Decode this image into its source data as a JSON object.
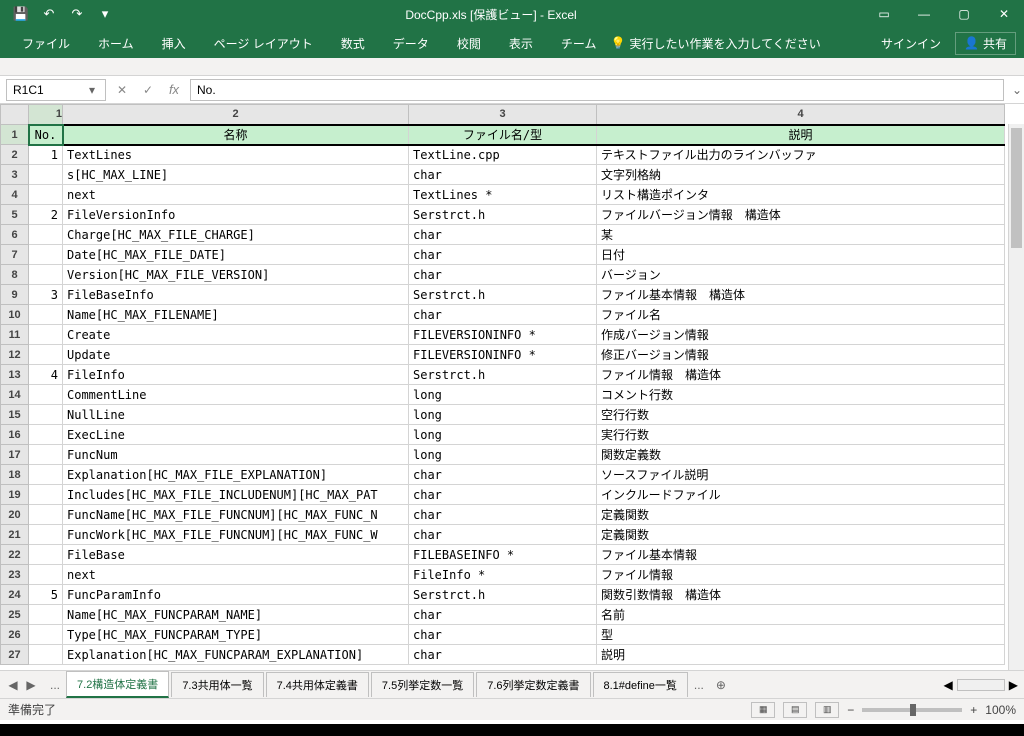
{
  "titlebar": {
    "title": "DocCpp.xls  [保護ビュー] - Excel"
  },
  "qat": {
    "save": "💾",
    "undo": "↶",
    "redo": "↷",
    "dd": "▾"
  },
  "winbtns": {
    "ribbon": "▭",
    "min": "—",
    "max": "▢",
    "close": "✕"
  },
  "tabs": {
    "file": "ファイル",
    "home": "ホーム",
    "insert": "挿入",
    "layout": "ページ レイアウト",
    "formula": "数式",
    "data": "データ",
    "review": "校閲",
    "view": "表示",
    "team": "チーム"
  },
  "tellme": {
    "icon": "💡",
    "text": "実行したい作業を入力してください"
  },
  "signin": "サインイン",
  "share": {
    "icon": "👤",
    "label": "共有"
  },
  "namebox": "R1C1",
  "fb": {
    "cancel": "✕",
    "enter": "✓",
    "fx": "fx"
  },
  "formula": "No.",
  "cols": {
    "c1": "1",
    "c2": "2",
    "c3": "3",
    "c4": "4"
  },
  "headers": {
    "no": "No.",
    "name": "名称",
    "file": "ファイル名/型",
    "desc": "説明"
  },
  "rows": [
    {
      "r": "2",
      "no": "1",
      "name": "TextLines",
      "file": "TextLine.cpp",
      "desc": "テキストファイル出力のラインバッファ"
    },
    {
      "r": "3",
      "no": "",
      "name": "s[HC_MAX_LINE]",
      "file": "char",
      "desc": "文字列格納"
    },
    {
      "r": "4",
      "no": "",
      "name": "next",
      "file": "TextLines *",
      "desc": "リスト構造ポインタ"
    },
    {
      "r": "5",
      "no": "2",
      "name": "FileVersionInfo",
      "file": "Serstrct.h",
      "desc": "ファイルバージョン情報　構造体"
    },
    {
      "r": "6",
      "no": "",
      "name": "Charge[HC_MAX_FILE_CHARGE]",
      "file": "char",
      "desc": "某"
    },
    {
      "r": "7",
      "no": "",
      "name": "Date[HC_MAX_FILE_DATE]",
      "file": "char",
      "desc": "日付"
    },
    {
      "r": "8",
      "no": "",
      "name": "Version[HC_MAX_FILE_VERSION]",
      "file": "char",
      "desc": "バージョン"
    },
    {
      "r": "9",
      "no": "3",
      "name": "FileBaseInfo",
      "file": "Serstrct.h",
      "desc": "ファイル基本情報　構造体"
    },
    {
      "r": "10",
      "no": "",
      "name": "Name[HC_MAX_FILENAME]",
      "file": "char",
      "desc": "ファイル名"
    },
    {
      "r": "11",
      "no": "",
      "name": "Create",
      "file": "FILEVERSIONINFO *",
      "desc": "作成バージョン情報"
    },
    {
      "r": "12",
      "no": "",
      "name": "Update",
      "file": "FILEVERSIONINFO *",
      "desc": "修正バージョン情報"
    },
    {
      "r": "13",
      "no": "4",
      "name": "FileInfo",
      "file": "Serstrct.h",
      "desc": "ファイル情報　構造体"
    },
    {
      "r": "14",
      "no": "",
      "name": "CommentLine",
      "file": "long",
      "desc": "コメント行数"
    },
    {
      "r": "15",
      "no": "",
      "name": "NullLine",
      "file": "long",
      "desc": "空行行数"
    },
    {
      "r": "16",
      "no": "",
      "name": "ExecLine",
      "file": "long",
      "desc": "実行行数"
    },
    {
      "r": "17",
      "no": "",
      "name": "FuncNum",
      "file": "long",
      "desc": "関数定義数"
    },
    {
      "r": "18",
      "no": "",
      "name": "Explanation[HC_MAX_FILE_EXPLANATION]",
      "file": "char",
      "desc": "ソースファイル説明"
    },
    {
      "r": "19",
      "no": "",
      "name": "Includes[HC_MAX_FILE_INCLUDENUM][HC_MAX_PAT",
      "file": "char",
      "desc": "インクルードファイル"
    },
    {
      "r": "20",
      "no": "",
      "name": "FuncName[HC_MAX_FILE_FUNCNUM][HC_MAX_FUNC_N",
      "file": "char",
      "desc": "定義関数"
    },
    {
      "r": "21",
      "no": "",
      "name": "FuncWork[HC_MAX_FILE_FUNCNUM][HC_MAX_FUNC_W",
      "file": "char",
      "desc": "定義関数"
    },
    {
      "r": "22",
      "no": "",
      "name": "FileBase",
      "file": "FILEBASEINFO *",
      "desc": "ファイル基本情報"
    },
    {
      "r": "23",
      "no": "",
      "name": "next",
      "file": "FileInfo *",
      "desc": "ファイル情報"
    },
    {
      "r": "24",
      "no": "5",
      "name": "FuncParamInfo",
      "file": "Serstrct.h",
      "desc": "関数引数情報　構造体"
    },
    {
      "r": "25",
      "no": "",
      "name": "Name[HC_MAX_FUNCPARAM_NAME]",
      "file": "char",
      "desc": "名前"
    },
    {
      "r": "26",
      "no": "",
      "name": "Type[HC_MAX_FUNCPARAM_TYPE]",
      "file": "char",
      "desc": "型"
    },
    {
      "r": "27",
      "no": "",
      "name": "Explanation[HC_MAX_FUNCPARAM_EXPLANATION]",
      "file": "char",
      "desc": "説明"
    }
  ],
  "sheets": {
    "dots": "...",
    "s1": "7.2構造体定義書",
    "s2": "7.3共用体一覧",
    "s3": "7.4共用体定義書",
    "s4": "7.5列挙定数一覧",
    "s5": "7.6列挙定数定義書",
    "s6": "8.1#define一覧",
    "dots2": "...",
    "new": "⊕"
  },
  "status": {
    "ready": "準備完了",
    "zoom": "100%",
    "minus": "−",
    "plus": "+"
  }
}
